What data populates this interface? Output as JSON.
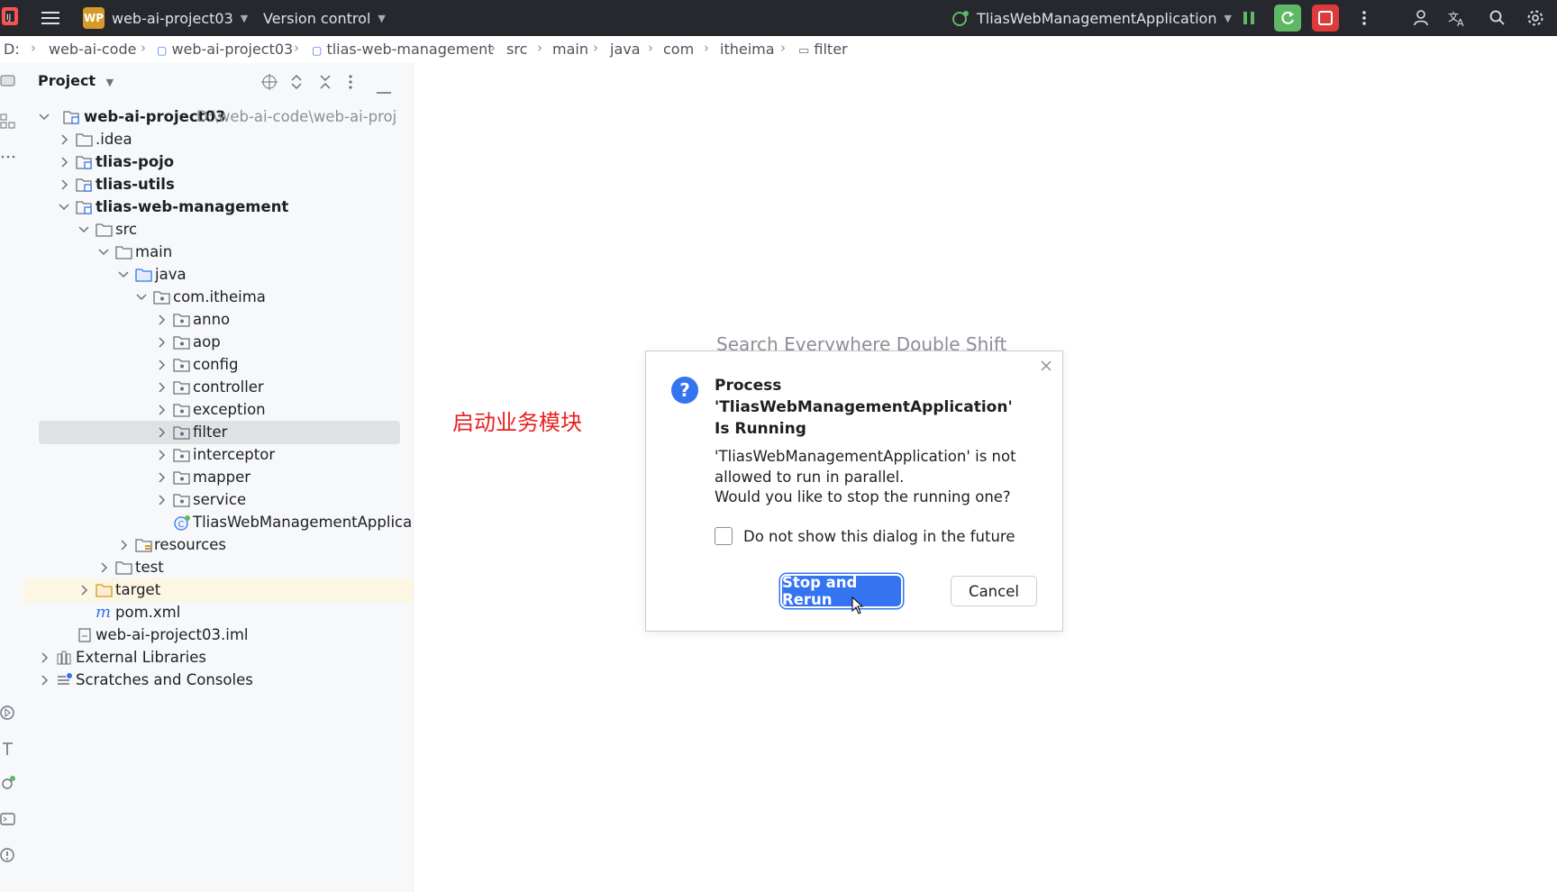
{
  "topbar": {
    "project_badge": "WP",
    "project_name": "web-ai-project03",
    "vcs_label": "Version control",
    "run_config": "TliasWebManagementApplication"
  },
  "breadcrumb": [
    "D:",
    "web-ai-code",
    "web-ai-project03",
    "tlias-web-management",
    "src",
    "main",
    "java",
    "com",
    "itheima",
    "filter"
  ],
  "project_panel": {
    "title": "Project",
    "tree": [
      {
        "label": "web-ai-project03",
        "path": "D:\\web-ai-code\\web-ai-proj",
        "bold": true
      },
      {
        "label": ".idea"
      },
      {
        "label": "tlias-pojo",
        "bold": true
      },
      {
        "label": "tlias-utils",
        "bold": true
      },
      {
        "label": "tlias-web-management",
        "bold": true
      },
      {
        "label": "src"
      },
      {
        "label": "main"
      },
      {
        "label": "java"
      },
      {
        "label": "com.itheima"
      },
      {
        "label": "anno"
      },
      {
        "label": "aop"
      },
      {
        "label": "config"
      },
      {
        "label": "controller"
      },
      {
        "label": "exception"
      },
      {
        "label": "filter"
      },
      {
        "label": "interceptor"
      },
      {
        "label": "mapper"
      },
      {
        "label": "service"
      },
      {
        "label": "TliasWebManagementApplica"
      },
      {
        "label": "resources"
      },
      {
        "label": "test"
      },
      {
        "label": "target"
      },
      {
        "label": "pom.xml"
      },
      {
        "label": "web-ai-project03.iml"
      },
      {
        "label": "External Libraries"
      },
      {
        "label": "Scratches and Consoles"
      }
    ]
  },
  "editor": {
    "hint": "Search Everywhere Double Shift",
    "annotation": "启动业务模块"
  },
  "dialog": {
    "title": "Process 'TliasWebManagementApplication' Is Running",
    "message_line1": "'TliasWebManagementApplication' is not allowed to run in parallel.",
    "message_line2": "Would you like to stop the running one?",
    "checkbox_label": "Do not show this dialog in the future",
    "primary_button": "Stop and Rerun",
    "secondary_button": "Cancel"
  },
  "colors": {
    "accent": "#3574f0",
    "topbar_bg": "#27282e",
    "annotation": "#e8201f",
    "stop_red": "#db3b3b",
    "rerun_green": "#5fb865"
  }
}
